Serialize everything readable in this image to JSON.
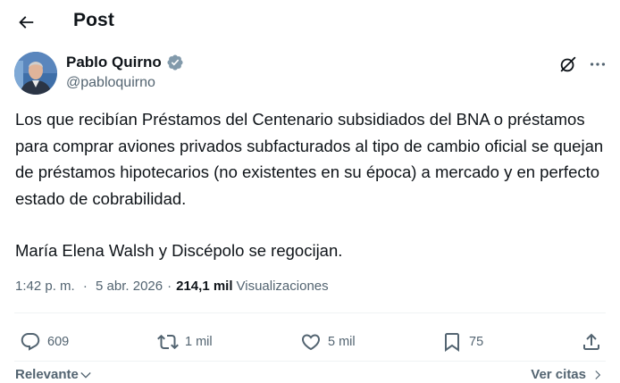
{
  "header": {
    "title": "Post",
    "back_icon": "arrow-left-icon"
  },
  "author": {
    "display_name": "Pablo Quirno",
    "handle": "@pabloquirno",
    "verified_icon": "verified-badge-icon",
    "verified_color": "#829aab"
  },
  "toolbar": {
    "grok_icon": "grok-icon",
    "more_icon": "more-horizontal-icon"
  },
  "tweet": {
    "paragraph_1": "Los que recibían Préstamos del Centenario subsidiados del BNA o préstamos para comprar aviones privados subfacturados al tipo de cambio oficial se quejan de préstamos hipotecarios (no existentes en su época) a mercado y en perfecto estado de cobrabilidad.",
    "paragraph_2": "María Elena Walsh y Discépolo se regocijan."
  },
  "meta": {
    "time": "1:42 p. m.",
    "date": "5 abr. 2026",
    "separator": "·",
    "views_count": "214,1 mil",
    "views_label": "Visualizaciones"
  },
  "actions": {
    "replies": "609",
    "reposts": "1 mil",
    "likes": "5 mil",
    "bookmarks": "75",
    "reply_icon": "reply-icon",
    "repost_icon": "repost-icon",
    "like_icon": "heart-icon",
    "bookmark_icon": "bookmark-icon",
    "share_icon": "share-icon"
  },
  "footer": {
    "sort_label": "Relevante",
    "quotes_label": "Ver citas"
  },
  "colors": {
    "text": "#0f1419",
    "secondary": "#536471",
    "divider": "#eff3f4"
  }
}
